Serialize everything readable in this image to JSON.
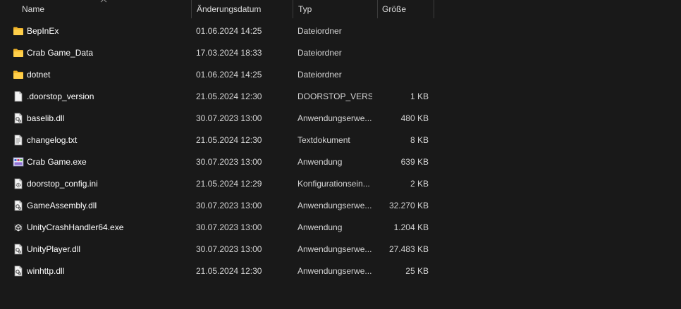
{
  "columns": {
    "name": "Name",
    "date": "Änderungsdatum",
    "type": "Typ",
    "size": "Größe"
  },
  "files": [
    {
      "icon": "folder-icon",
      "name": "BepInEx",
      "date": "01.06.2024 14:25",
      "type": "Dateiordner",
      "size": ""
    },
    {
      "icon": "folder-icon",
      "name": "Crab Game_Data",
      "date": "17.03.2024 18:33",
      "type": "Dateiordner",
      "size": ""
    },
    {
      "icon": "folder-icon",
      "name": "dotnet",
      "date": "01.06.2024 14:25",
      "type": "Dateiordner",
      "size": ""
    },
    {
      "icon": "file-icon",
      "name": ".doorstop_version",
      "date": "21.05.2024 12:30",
      "type": "DOORSTOP_VERSI...",
      "size": "1 KB"
    },
    {
      "icon": "dll-icon",
      "name": "baselib.dll",
      "date": "30.07.2023 13:00",
      "type": "Anwendungserwe...",
      "size": "480 KB"
    },
    {
      "icon": "text-file-icon",
      "name": "changelog.txt",
      "date": "21.05.2024 12:30",
      "type": "Textdokument",
      "size": "8 KB"
    },
    {
      "icon": "app-icon",
      "name": "Crab Game.exe",
      "date": "30.07.2023 13:00",
      "type": "Anwendung",
      "size": "639 KB"
    },
    {
      "icon": "config-file-icon",
      "name": "doorstop_config.ini",
      "date": "21.05.2024 12:29",
      "type": "Konfigurationsein...",
      "size": "2 KB"
    },
    {
      "icon": "dll-icon",
      "name": "GameAssembly.dll",
      "date": "30.07.2023 13:00",
      "type": "Anwendungserwe...",
      "size": "32.270 KB"
    },
    {
      "icon": "unity-exe-icon",
      "name": "UnityCrashHandler64.exe",
      "date": "30.07.2023 13:00",
      "type": "Anwendung",
      "size": "1.204 KB"
    },
    {
      "icon": "dll-icon",
      "name": "UnityPlayer.dll",
      "date": "30.07.2023 13:00",
      "type": "Anwendungserwe...",
      "size": "27.483 KB"
    },
    {
      "icon": "dll-icon",
      "name": "winhttp.dll",
      "date": "21.05.2024 12:30",
      "type": "Anwendungserwe...",
      "size": "25 KB"
    }
  ]
}
